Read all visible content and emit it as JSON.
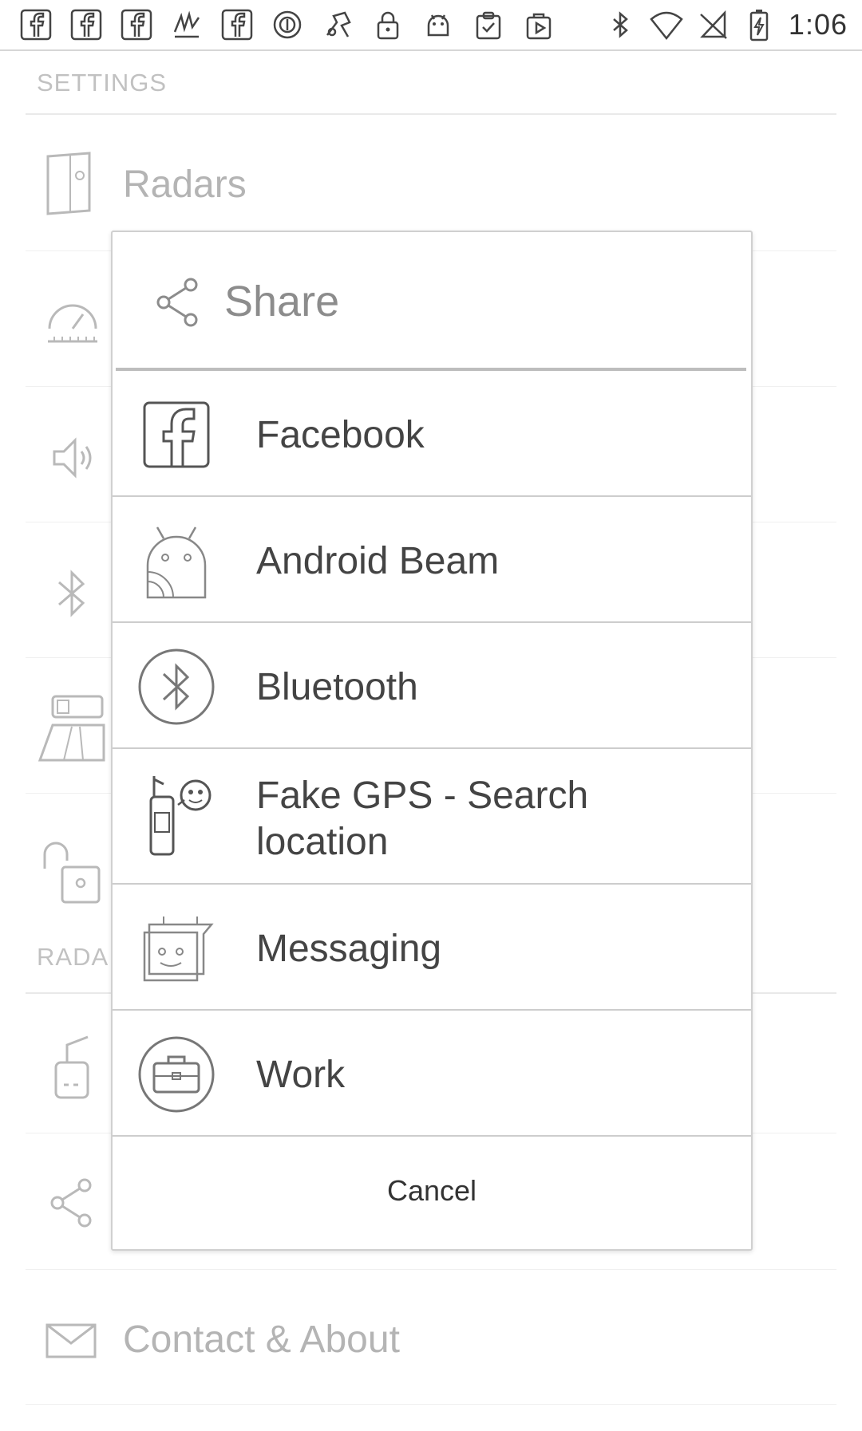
{
  "status_bar": {
    "left_icons": [
      "facebook-icon",
      "facebook-icon",
      "facebook-icon",
      "app-icon",
      "facebook-icon",
      "circle-icon",
      "fake-gps-icon",
      "lock-icon",
      "android-icon",
      "clipboard-check-icon",
      "play-store-icon"
    ],
    "right_icons": [
      "bluetooth-icon",
      "wifi-icon",
      "no-sim-icon",
      "battery-charging-icon"
    ],
    "time": "1:06"
  },
  "background": {
    "section_settings": "SETTINGS",
    "section_radars": "RADA",
    "item_radars": "Radars",
    "item_contact": "Contact & About"
  },
  "dialog": {
    "title": "Share",
    "items": [
      {
        "label": "Facebook",
        "icon": "facebook-icon"
      },
      {
        "label": "Android Beam",
        "icon": "android-beam-icon"
      },
      {
        "label": "Bluetooth",
        "icon": "bluetooth-icon"
      },
      {
        "label": "Fake GPS - Search location",
        "icon": "fake-gps-icon"
      },
      {
        "label": "Messaging",
        "icon": "messaging-icon"
      },
      {
        "label": "Work",
        "icon": "work-briefcase-icon"
      }
    ],
    "cancel_label": "Cancel"
  },
  "colors": {
    "divider": "#cdcdcd",
    "text": "#444444",
    "muted": "#8c8c8c"
  }
}
